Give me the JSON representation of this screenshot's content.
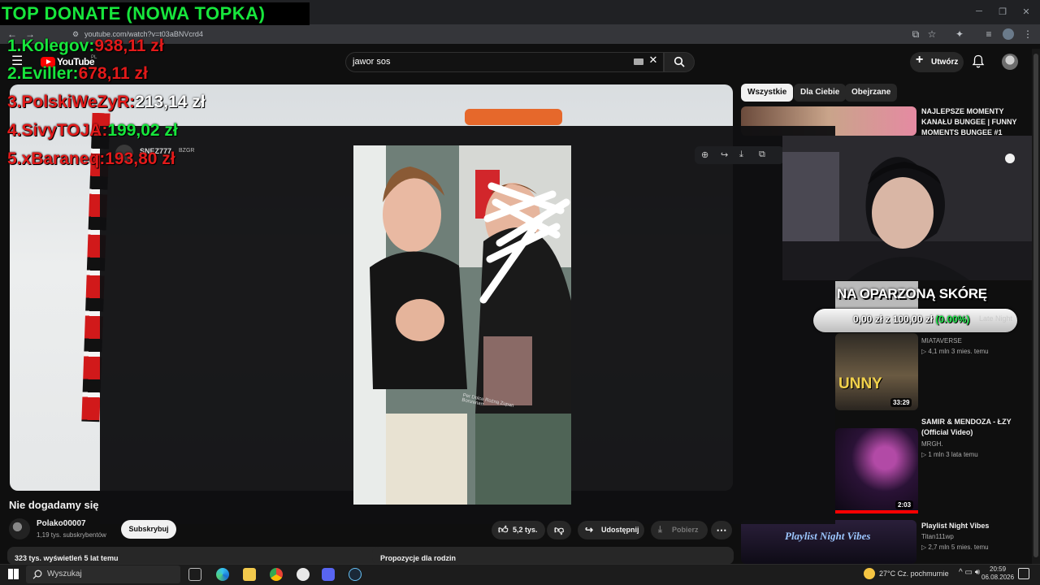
{
  "browser": {
    "url": "youtube.com/watch?v=t03aBNVcrd4"
  },
  "header": {
    "logo_text": "YouTube",
    "logo_country": "PL",
    "search_value": "jawor sos",
    "create_label": "Utwórz"
  },
  "chips": [
    "Wszystkie",
    "Dla Ciebie",
    "Obejrzane"
  ],
  "donate": {
    "title": "TOP DONATE (NOWA TOPKA)",
    "rows": [
      {
        "name": "1.Kolegov:",
        "amount": "938,11 zł"
      },
      {
        "name": "2.Eviller:",
        "amount": "678,11 zł"
      },
      {
        "name": "3.PolskiWeZyR:",
        "amount": "213,14 zł"
      },
      {
        "name": "4.SivyTOJA:",
        "amount": "199,02 zł"
      },
      {
        "name": "5.xBaraneq:",
        "amount": "193,80 zł"
      }
    ]
  },
  "goal": {
    "title": "NA OPARZONĄ SKÓRĘ",
    "text": "0,00 zł z 100,00 zł",
    "percent_text": "(0.00%)",
    "ghost": "Late Night",
    "progress": 0
  },
  "sidebar": {
    "items": [
      {
        "title": "NAJLEPSZE MOMENTY KANAŁU BUNGEE | FUNNY MOMENTS BUNGEE #1",
        "channel": "",
        "meta": "",
        "duration": ""
      },
      {
        "title": "",
        "channel": "MIATAVERSE",
        "meta": "▷ 4,1 mln  3 mies. temu",
        "duration": "33:29",
        "thumb_text": "UNNY"
      },
      {
        "title": "SAMIR & MENDOZA - ŁZY (Official Video)",
        "channel": "MRGH.",
        "meta": "▷ 1 mln  3 lata temu",
        "duration": "2:03"
      },
      {
        "title": "Playlist Night Vibes",
        "channel": "Titan111wp",
        "meta": "▷ 2,7 mln  5 mies. temu",
        "duration": "",
        "thumb_text": "Playlist Night Vibes"
      }
    ]
  },
  "modal": {
    "user": "SNEZ777",
    "badge": "BZGR",
    "photo_caption": "Per Dolce Rożną Zupan Bonzenarr"
  },
  "video": {
    "title": "Nie dogadamy się",
    "channel": "Polako00007",
    "subscribers": "1,19 tys. subskrybentów",
    "subscribe_label": "Subskrybuj",
    "likes": "5,2 tys.",
    "share_label": "Udostępnij",
    "download_label": "Pobierz",
    "views": "323 tys. wyświetleń  5 lat temu",
    "family_label": "Propozycje dla rodzin"
  },
  "taskbar": {
    "search_placeholder": "Wyszukaj",
    "temperature": "27°C  Cz. pochmurnie",
    "time": "20:59",
    "date": "06.08.2026"
  }
}
